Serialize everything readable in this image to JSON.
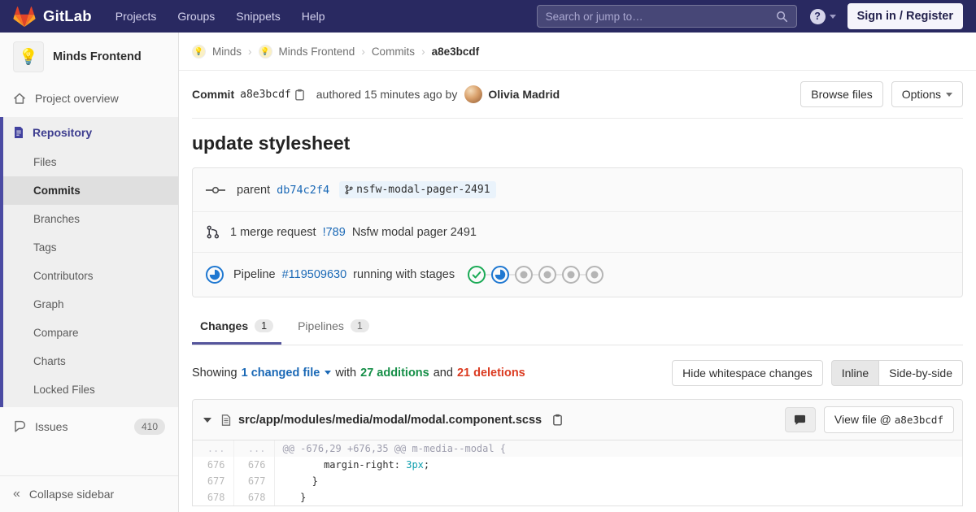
{
  "navbar": {
    "brand": "GitLab",
    "links": [
      "Projects",
      "Groups",
      "Snippets",
      "Help"
    ],
    "search_placeholder": "Search or jump to…",
    "sign_in_label": "Sign in / Register"
  },
  "glyphs": {
    "help": "?",
    "collapse": "«",
    "breadcrumb_sep": "›",
    "project_avatar_emoji": "💡",
    "crumb_avatar_emoji": "💡"
  },
  "sidebar": {
    "project_name": "Minds Frontend",
    "overview_label": "Project overview",
    "repository_label": "Repository",
    "repo_items": [
      "Files",
      "Commits",
      "Branches",
      "Tags",
      "Contributors",
      "Graph",
      "Compare",
      "Charts",
      "Locked Files"
    ],
    "active_repo_item": "Commits",
    "issues_label": "Issues",
    "issues_count": "410",
    "collapse_label": "Collapse sidebar"
  },
  "breadcrumb": {
    "group": "Minds",
    "project": "Minds Frontend",
    "section": "Commits",
    "current": "a8e3bcdf"
  },
  "commit": {
    "label": "Commit",
    "sha": "a8e3bcdf",
    "authored_text": "authored 15 minutes ago by",
    "author_name": "Olivia Madrid",
    "browse_files_label": "Browse files",
    "options_label": "Options",
    "title": "update stylesheet",
    "parent_label": "parent",
    "parent_sha": "db74c2f4",
    "branch_name": "nsfw-modal-pager-2491",
    "merge_request_text": "1 merge request",
    "merge_request_ref": "!789",
    "merge_request_title": "Nsfw modal pager 2491"
  },
  "pipeline": {
    "label": "Pipeline",
    "id": "#119509630",
    "status_text": "running with stages",
    "stages": [
      "success",
      "running",
      "created",
      "created",
      "created",
      "created"
    ],
    "colors": {
      "success": "#1aaa55",
      "running": "#1f78d1",
      "created": "#b5b5b5"
    }
  },
  "tabs": {
    "changes_label": "Changes",
    "changes_count": "1",
    "pipelines_label": "Pipelines",
    "pipelines_count": "1"
  },
  "diff_controls": {
    "showing": "Showing",
    "changed_file": "1 changed file",
    "with": "with",
    "additions": "27 additions",
    "and": "and",
    "deletions": "21 deletions",
    "hide_whitespace_label": "Hide whitespace changes",
    "inline_label": "Inline",
    "side_by_side_label": "Side-by-side"
  },
  "diff_file": {
    "path": "src/app/modules/media/modal/modal.component.scss",
    "view_file_label": "View file @",
    "view_file_sha": "a8e3bcdf",
    "lines": [
      {
        "old": "...",
        "new": "...",
        "type": "hunk",
        "code_pre": "@@ -676,29 +676,35 @@ m-media--modal {"
      },
      {
        "old": "676",
        "new": "676",
        "type": "context",
        "code_pre": "       margin-right: ",
        "code_num": "3px",
        "code_post": ";"
      },
      {
        "old": "677",
        "new": "677",
        "type": "context",
        "code_pre": "     }"
      },
      {
        "old": "678",
        "new": "678",
        "type": "context",
        "code_pre": "   }"
      }
    ]
  }
}
